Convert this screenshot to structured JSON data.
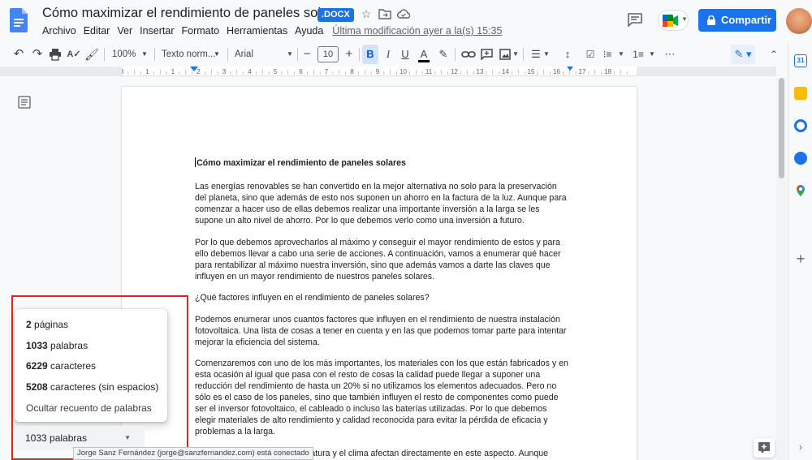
{
  "titlebar": {
    "doc_title": "Cómo maximizar el rendimiento de paneles solares",
    "format_badge": ".DOCX",
    "share_label": "Compartir"
  },
  "menubar": {
    "items": [
      "Archivo",
      "Editar",
      "Ver",
      "Insertar",
      "Formato",
      "Herramientas",
      "Ayuda"
    ],
    "last_modified": "Última modificación ayer a la(s) 15:35"
  },
  "toolbar": {
    "zoom": "100%",
    "style": "Texto norm...",
    "font": "Arial",
    "font_size": "10"
  },
  "ruler": {
    "ticks": [
      "3",
      "1",
      "1",
      "2",
      "3",
      "4",
      "5",
      "6",
      "7",
      "8",
      "9",
      "10",
      "11",
      "12",
      "13",
      "14",
      "15",
      "16",
      "17",
      "18"
    ]
  },
  "document": {
    "heading": "Cómo maximizar el rendimiento de paneles solares",
    "p1": "Las energías renovables se han convertido en la mejor alternativa no solo para la preservación del planeta, sino que además de esto nos suponen un ahorro en la factura de la luz. Aunque para comenzar a hacer uso de ellas debemos realizar una importante inversión a la larga se les supone un alto nivel de ahorro. Por lo que debemos verlo como una inversión a futuro.",
    "p2": "Por lo que debemos aprovecharlos al máximo y conseguir el mayor rendimiento de estos y para ello debemos llevar a cabo una serie de acciones. A continuación, vamos a enumerar qué hacer para rentabilizar al máximo nuestra inversión, sino que además vamos a darte las claves que influyen en un mayor rendimiento de nuestros paneles solares.",
    "q1": "¿Qué factores influyen en el rendimiento de paneles solares?",
    "p3": "Podemos enumerar unos cuantos factores que influyen en el rendimiento de nuestra instalación fotovoltaica. Una lista de cosas a tener en cuenta y en las que podemos tomar parte para intentar mejorar la eficiencia del sistema.",
    "p4": "Comenzaremos con uno de los más importantes, los materiales con los que están fabricados y en esta ocasión al igual que pasa con el resto de cosas la calidad puede llegar a suponer una reducción del rendimiento de hasta un 20% si no utilizamos los elementos adecuados. Pero no sólo es el caso de los paneles, sino que también influyen el resto de componentes como puede ser el inversor fotovoltaico, el cableado o incluso las baterías utilizadas. Por lo que debemos elegir materiales de alto rendimiento y calidad reconocida para evitar la pérdida de eficacia y problemas a la larga.",
    "p5": "...ratura y el clima afectan directamente en este aspecto. Aunque"
  },
  "word_count": {
    "pages_num": "2",
    "pages_label": " páginas",
    "words_num": "1033",
    "words_label": " palabras",
    "chars_num": "6229",
    "chars_label": " caracteres",
    "chars_ns_num": "5208",
    "chars_ns_label": " caracteres (sin espacios)",
    "hide_label": "Ocultar recuento de palabras",
    "bar_label": "1033 palabras"
  },
  "tooltip": "Jorge Sanz Fernández (jorge@sanzfernandez.com) está conectado",
  "colors": {
    "accent": "#1a73e8",
    "highlight_box": "#e02121"
  }
}
